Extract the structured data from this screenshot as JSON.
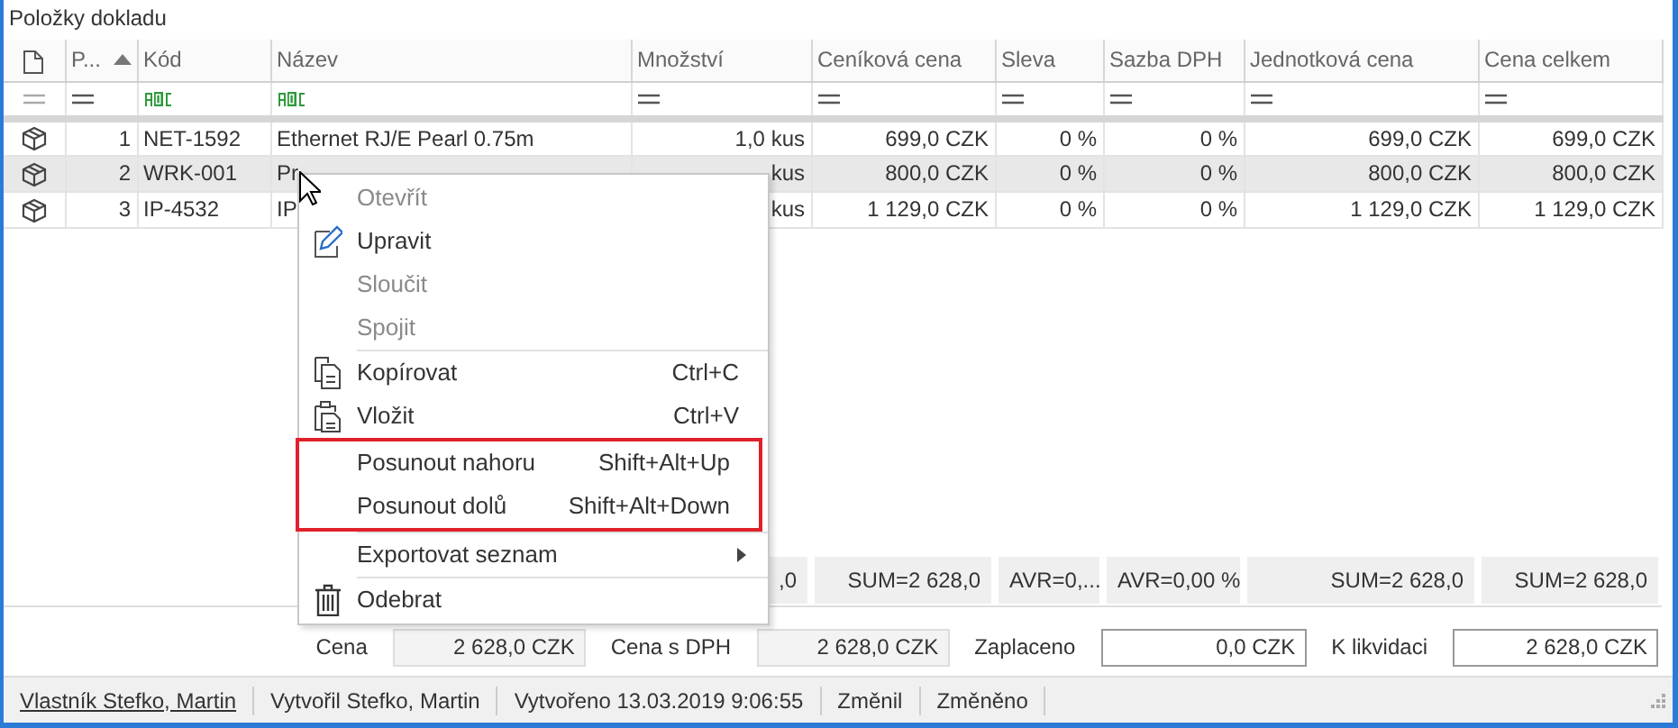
{
  "panel": {
    "title": "Položky dokladu"
  },
  "grid": {
    "columns": [
      {
        "label": "P...",
        "sorted": true
      },
      {
        "label": "Kód",
        "sorted": false
      },
      {
        "label": "Název",
        "sorted": false
      },
      {
        "label": "Množství",
        "sorted": false
      },
      {
        "label": "Ceníková cena",
        "sorted": false
      },
      {
        "label": "Sleva",
        "sorted": false
      },
      {
        "label": "Sazba DPH",
        "sorted": false
      },
      {
        "label": "Jednotková cena",
        "sorted": false
      },
      {
        "label": "Cena celkem",
        "sorted": false
      }
    ],
    "rows": [
      {
        "selected": false,
        "cells": [
          "1",
          "NET-1592",
          "Ethernet RJ/E Pearl 0.75m",
          "1,0 kus",
          "699,0 CZK",
          "0 %",
          "0 %",
          "699,0 CZK",
          "699,0 CZK"
        ]
      },
      {
        "selected": true,
        "cells": [
          "2",
          "WRK-001",
          "Pr",
          "kus",
          "800,0 CZK",
          "0 %",
          "0 %",
          "800,0 CZK",
          "800,0 CZK"
        ]
      },
      {
        "selected": false,
        "cells": [
          "3",
          "IP-4532",
          "IP",
          "kus",
          "1 129,0 CZK",
          "0 %",
          "0 %",
          "1 129,0 CZK",
          "1 129,0 CZK"
        ]
      }
    ],
    "summary": [
      ",0",
      "SUM=2 628,0",
      "AVR=0,...",
      "AVR=0,00 %",
      "SUM=2 628,0",
      "SUM=2 628,0"
    ]
  },
  "totals": [
    {
      "label": "Cena",
      "value": "2 628,0 CZK",
      "readonly": true
    },
    {
      "label": "Cena s DPH",
      "value": "2 628,0 CZK",
      "readonly": true
    },
    {
      "label": "Zaplaceno",
      "value": "0,0 CZK",
      "readonly": false
    },
    {
      "label": "K likvidaci",
      "value": "2 628,0 CZK",
      "readonly": false
    }
  ],
  "status_bar": [
    {
      "text": "Vlastník Stefko, Martin",
      "link": true
    },
    {
      "text": "Vytvořil Stefko, Martin",
      "link": false
    },
    {
      "text": "Vytvořeno 13.03.2019 9:06:55",
      "link": false
    },
    {
      "text": "Změnil",
      "link": false
    },
    {
      "text": "Změněno",
      "link": false
    }
  ],
  "context_menu": {
    "sections": [
      {
        "highlighted": false,
        "items": [
          {
            "label": "Otevřít",
            "disabled": true
          },
          {
            "label": "Upravit",
            "disabled": false
          },
          {
            "label": "Sloučit",
            "disabled": true
          },
          {
            "label": "Spojit",
            "disabled": true
          }
        ]
      },
      {
        "highlighted": false,
        "items": [
          {
            "label": "Kopírovat",
            "shortcut": "Ctrl+C",
            "disabled": false
          },
          {
            "label": "Vložit",
            "shortcut": "Ctrl+V",
            "disabled": false
          }
        ]
      },
      {
        "highlighted": true,
        "items": [
          {
            "label": "Posunout nahoru",
            "shortcut": "Shift+Alt+Up",
            "disabled": false
          },
          {
            "label": "Posunout dolů",
            "shortcut": "Shift+Alt+Down",
            "disabled": false
          }
        ]
      },
      {
        "highlighted": false,
        "items": [
          {
            "label": "Exportovat seznam",
            "submenu": true,
            "disabled": false
          }
        ]
      },
      {
        "highlighted": false,
        "items": [
          {
            "label": "Odebrat",
            "disabled": false
          }
        ]
      }
    ]
  }
}
